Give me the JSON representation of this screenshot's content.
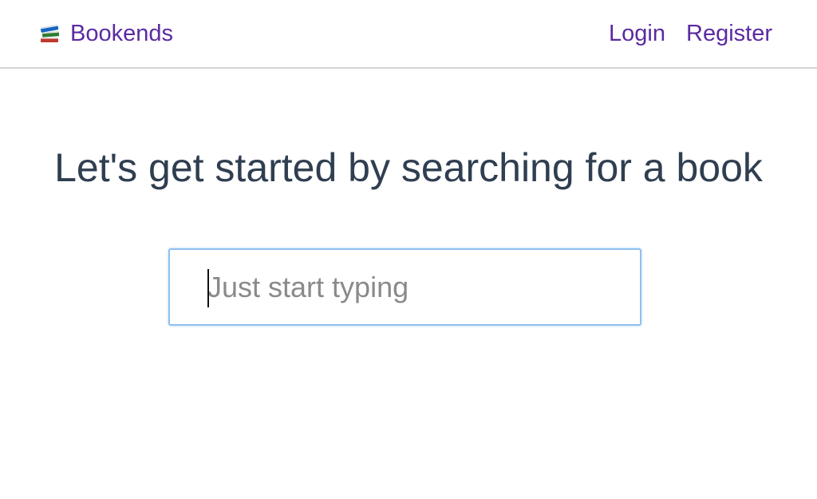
{
  "navbar": {
    "brand": {
      "icon": "books-icon",
      "label": "Bookends"
    },
    "links": [
      {
        "label": "Login"
      },
      {
        "label": "Register"
      }
    ]
  },
  "main": {
    "heading": "Let's get started by searching for a book",
    "search": {
      "placeholder": "Just start typing",
      "value": ""
    }
  },
  "colors": {
    "link": "#5b2aa0",
    "heading": "#2f3e50",
    "focus_border": "#8fbff0",
    "divider": "#d4d4d4"
  }
}
